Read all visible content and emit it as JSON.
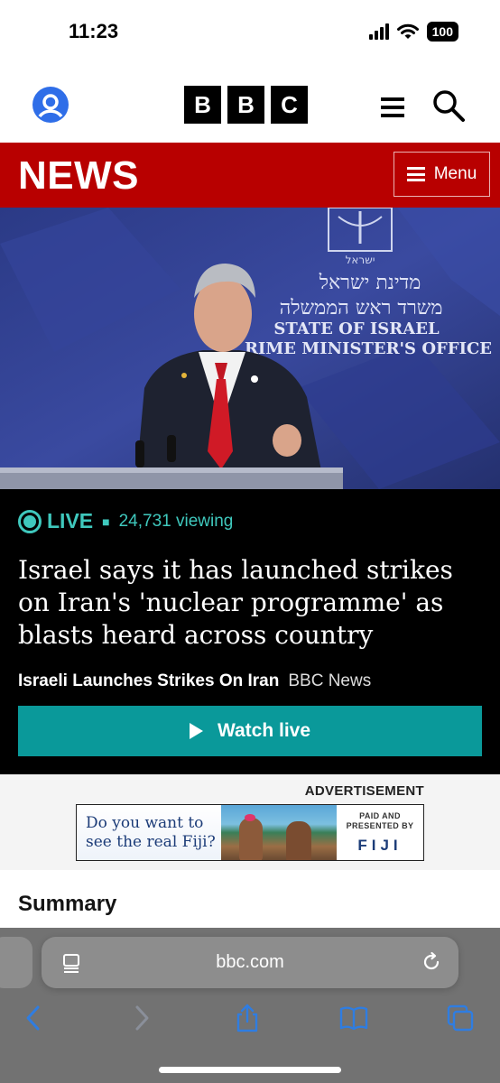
{
  "status_bar": {
    "time": "11:23",
    "battery": "100"
  },
  "header": {
    "logo_letters": [
      "B",
      "B",
      "C"
    ]
  },
  "news_bar": {
    "title": "NEWS",
    "menu_label": "Menu"
  },
  "hero": {
    "sign_hebrew_line1": "מדינת ישראל",
    "sign_hebrew_line2": "משרד ראש הממשלה",
    "sign_line1": "STATE OF ISRAEL",
    "sign_line2": "RIME MINISTER'S OFFICE"
  },
  "live": {
    "label": "LIVE",
    "viewing": "24,731 viewing",
    "headline": "Israel says it has launched strikes on Iran's 'nuclear programme' as blasts heard across country",
    "topic": "Israeli Launches Strikes On Iran",
    "source": "BBC News",
    "watch_label": "Watch live"
  },
  "advertisement": {
    "label": "ADVERTISEMENT",
    "text": "Do you want to see the real Fiji?",
    "paid": "PAID AND PRESENTED BY",
    "brand": "FIJI"
  },
  "summary": {
    "title": "Summary"
  },
  "browser": {
    "url": "bbc.com"
  },
  "colors": {
    "bbc_red": "#b80000",
    "live_teal": "#3fc8bd",
    "watch_button": "#0a999a",
    "toolbar_blue": "#2f7de1"
  }
}
